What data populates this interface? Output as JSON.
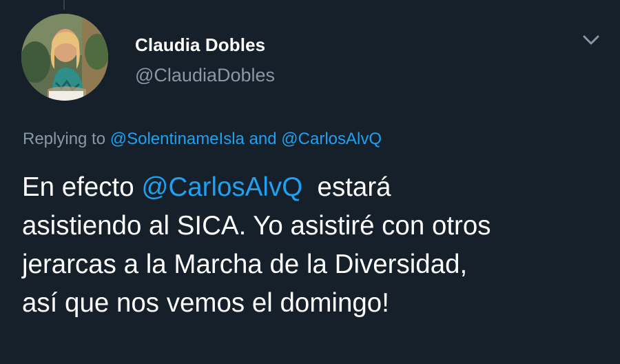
{
  "tweet": {
    "author": {
      "display_name": "Claudia Dobles",
      "handle": "@ClaudiaDobles"
    },
    "menu_icon": "chevron-down-icon",
    "reply": {
      "prefix": "Replying to",
      "mention_1": "@SolentinameIsla",
      "connector": "and",
      "mention_2": "@CarlosAlvQ"
    },
    "body": {
      "line1_start": "En efecto",
      "mention": "@CarlosAlvQ",
      "line1_end": "estará",
      "line2": "asistiendo al SICA. Yo asistiré con otros",
      "line3": "jerarcas a la Marcha de la Diversidad,",
      "line4": "así que nos vemos el domingo!"
    }
  },
  "colors": {
    "background": "#15202b",
    "text": "#ffffff",
    "secondary": "#8899a6",
    "link": "#1da1f2"
  }
}
